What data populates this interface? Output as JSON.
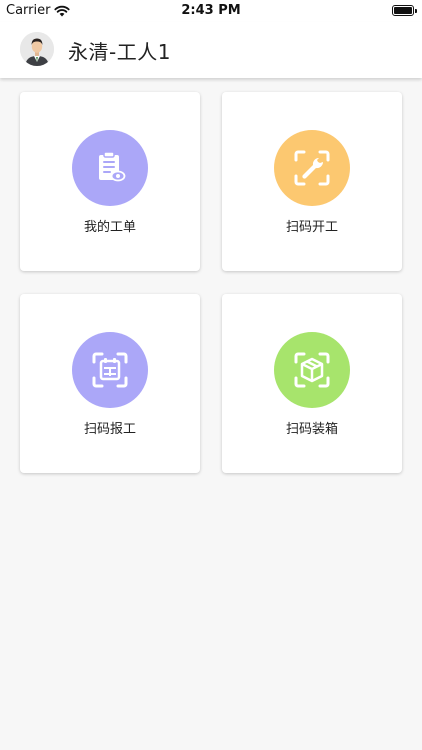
{
  "status_bar": {
    "carrier": "Carrier",
    "time": "2:43 PM"
  },
  "header": {
    "title": "永清-工人1",
    "avatar_icon": "user-avatar-icon"
  },
  "tiles": [
    {
      "label": "我的工单",
      "icon": "clipboard-eye-icon",
      "color": "#aba7f8"
    },
    {
      "label": "扫码开工",
      "icon": "scan-wrench-icon",
      "color": "#fcc870"
    },
    {
      "label": "扫码报工",
      "icon": "scan-report-icon",
      "color": "#aba7f8"
    },
    {
      "label": "扫码装箱",
      "icon": "scan-box-icon",
      "color": "#a7e46c"
    }
  ],
  "colors": {
    "background": "#f7f7f7",
    "card": "#ffffff"
  }
}
